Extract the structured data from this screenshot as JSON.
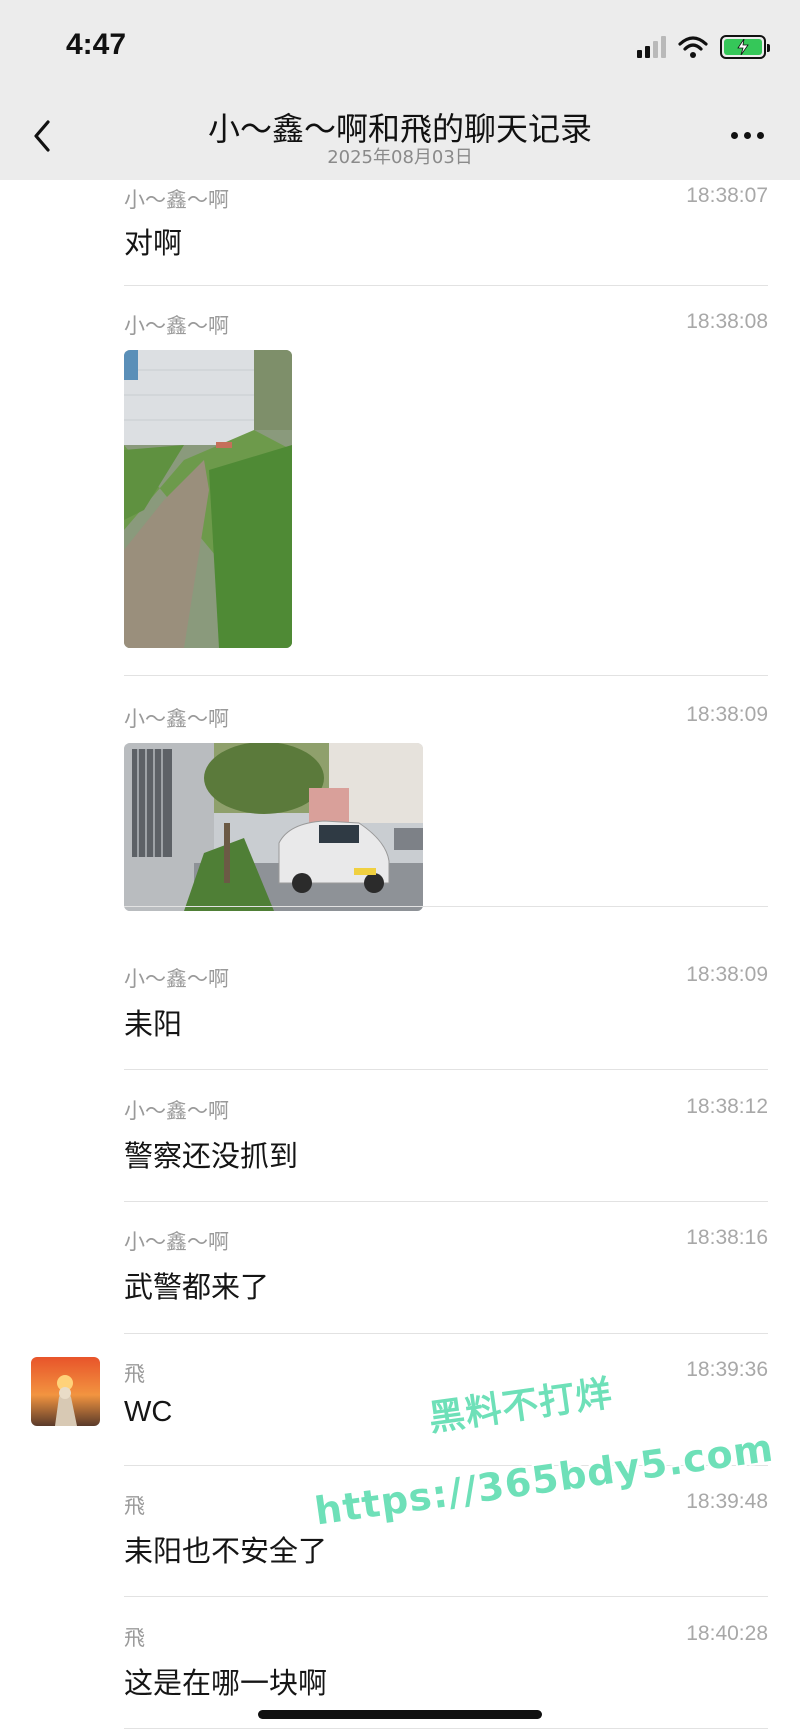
{
  "status_bar": {
    "time": "4:47"
  },
  "header": {
    "title": "小～鑫～啊和飛的聊天记录",
    "date": "2025年08月03日"
  },
  "messages": [
    {
      "sender": "小～鑫～啊",
      "time": "18:38:07",
      "type": "text",
      "text": "对啊"
    },
    {
      "sender": "小～鑫～啊",
      "time": "18:38:08",
      "type": "image"
    },
    {
      "sender": "小～鑫～啊",
      "time": "18:38:09",
      "type": "image"
    },
    {
      "sender": "小～鑫～啊",
      "time": "18:38:09",
      "type": "text",
      "text": "耒阳"
    },
    {
      "sender": "小～鑫～啊",
      "time": "18:38:12",
      "type": "text",
      "text": "警察还没抓到"
    },
    {
      "sender": "小～鑫～啊",
      "time": "18:38:16",
      "type": "text",
      "text": "武警都来了"
    },
    {
      "sender": "飛",
      "time": "18:39:36",
      "type": "text",
      "text": "WC"
    },
    {
      "sender": "飛",
      "time": "18:39:48",
      "type": "text",
      "text": "耒阳也不安全了"
    },
    {
      "sender": "飛",
      "time": "18:40:28",
      "type": "text",
      "text": "这是在哪一块啊"
    }
  ],
  "watermark": {
    "line1": "黑料不打烊",
    "line2": "https://365bdy5.com"
  },
  "colors": {
    "header_bg": "#ececec",
    "battery": "#35c759",
    "watermark": "#6ee0b8",
    "timestamp": "#a8a8a8"
  }
}
